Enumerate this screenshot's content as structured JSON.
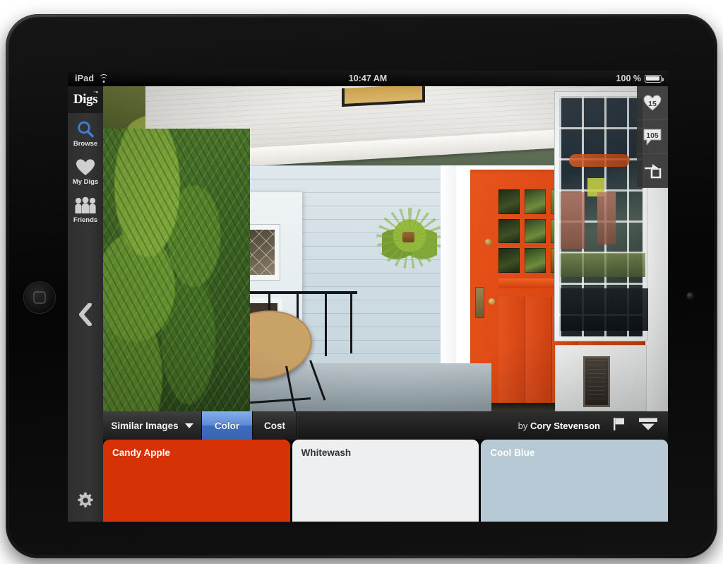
{
  "status_bar": {
    "carrier": "iPad",
    "wifi_icon": "wifi-icon",
    "time": "10:47 AM",
    "battery_percent": "100 %",
    "battery_icon": "battery-icon"
  },
  "sidebar": {
    "logo": {
      "text": "Digs",
      "trademark": "™"
    },
    "items": [
      {
        "label": "Browse",
        "icon": "search-icon"
      },
      {
        "label": "My Digs",
        "icon": "heart-icon"
      },
      {
        "label": "Friends",
        "icon": "people-icon"
      }
    ],
    "back_icon": "chevron-left-icon",
    "settings_icon": "gear-icon"
  },
  "photo": {
    "alt": "Front porch with bright orange craftsman door, pale blue siding, wicker saucer chair and hanging fern"
  },
  "actions": [
    {
      "name": "like",
      "icon": "heart-icon",
      "count": "15"
    },
    {
      "name": "comment",
      "icon": "comment-icon",
      "count": "105"
    },
    {
      "name": "share",
      "icon": "share-icon",
      "count": ""
    }
  ],
  "toolbar": {
    "similar_images_label": "Similar Images",
    "dropdown_icon": "chevron-down-icon",
    "tabs": [
      {
        "label": "Color",
        "active": true
      },
      {
        "label": "Cost",
        "active": false
      }
    ],
    "byline_prefix": "by",
    "author": "Cory Stevenson",
    "flag_icon": "flag-icon",
    "collapse_icon": "chevron-down-stack-icon"
  },
  "swatches": [
    {
      "name": "Candy Apple",
      "color": "#D63205",
      "text_color": "#ffffff"
    },
    {
      "name": "Whitewash",
      "color": "#EDEFF1",
      "text_color": "#333333"
    },
    {
      "name": "Cool Blue",
      "color": "#B6C9D5",
      "text_color": "#ffffff"
    }
  ],
  "theme": {
    "accent_blue": "#5f8ad6",
    "sidebar_bg": "#313131",
    "toolbar_bg": "#232323"
  }
}
